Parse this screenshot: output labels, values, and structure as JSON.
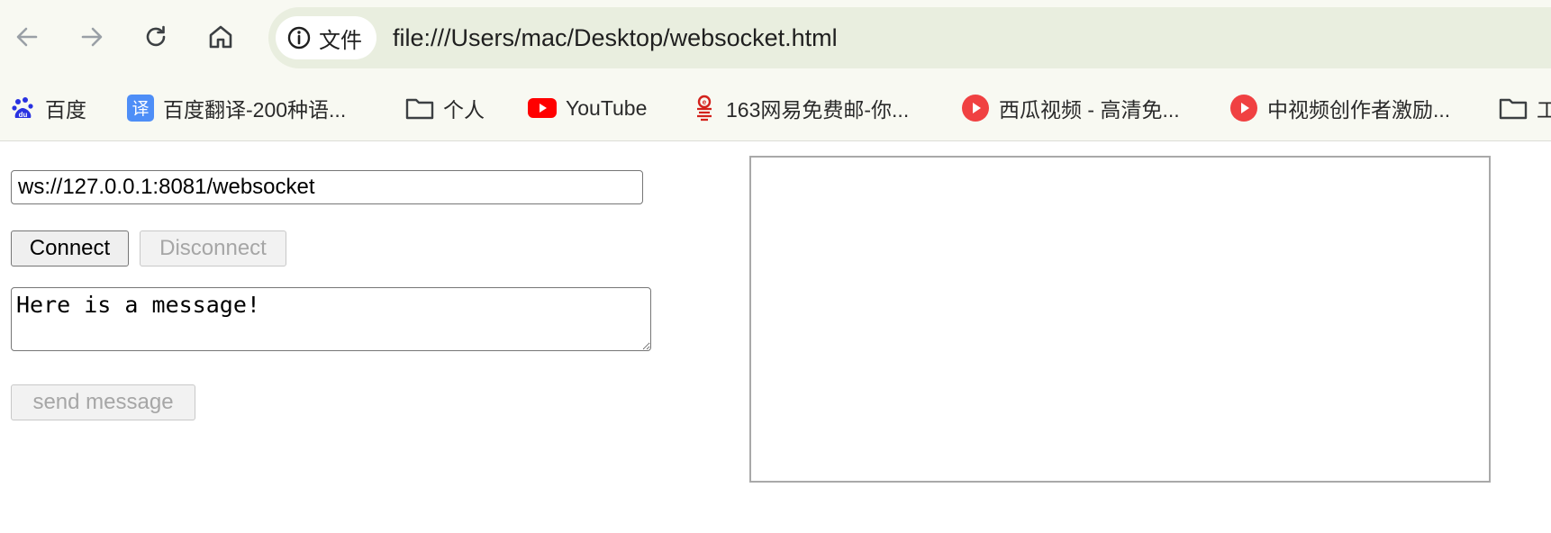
{
  "browser": {
    "site_chip_label": "文件",
    "url": "file:///Users/mac/Desktop/websocket.html"
  },
  "bookmarks": [
    {
      "label": "百度",
      "icon": "baidu-icon"
    },
    {
      "label": "百度翻译-200种语...",
      "icon": "baidu-translate-icon"
    },
    {
      "label": "个人",
      "icon": "folder-icon"
    },
    {
      "label": "YouTube",
      "icon": "youtube-icon"
    },
    {
      "label": "163网易免费邮-你...",
      "icon": "netease-mail-icon"
    },
    {
      "label": "西瓜视频 - 高清免...",
      "icon": "xigua-video-icon"
    },
    {
      "label": "中视频创作者激励...",
      "icon": "zhongshipin-icon"
    },
    {
      "label": "工",
      "icon": "folder-icon"
    }
  ],
  "page": {
    "ws_url_value": "ws://127.0.0.1:8081/websocket",
    "connect_label": "Connect",
    "disconnect_label": "Disconnect",
    "message_value": "Here is a message!",
    "send_label": "send message"
  },
  "colors": {
    "toolbar_bg": "#f8f9f2",
    "omnibox_bg": "#e9eedf",
    "disabled_text": "#a6a6a6"
  }
}
